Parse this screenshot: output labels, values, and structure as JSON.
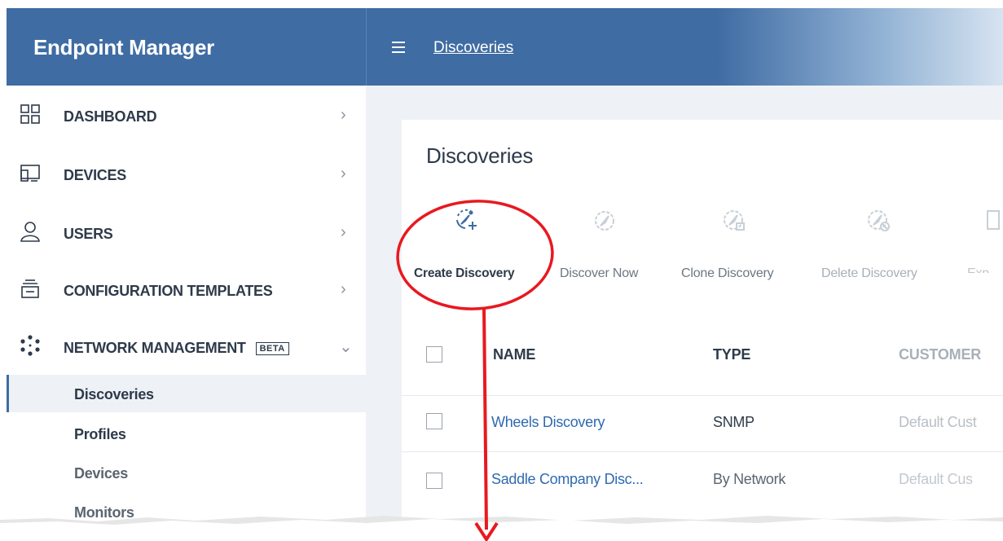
{
  "app": {
    "title": "Endpoint Manager"
  },
  "header": {
    "breadcrumb": "Discoveries"
  },
  "sidebar": {
    "items": [
      {
        "label": "DASHBOARD",
        "icon": "dashboard-icon"
      },
      {
        "label": "DEVICES",
        "icon": "devices-icon"
      },
      {
        "label": "USERS",
        "icon": "user-icon"
      },
      {
        "label": "CONFIGURATION TEMPLATES",
        "icon": "templates-icon"
      },
      {
        "label": "NETWORK MANAGEMENT",
        "icon": "network-icon",
        "badge": "BETA",
        "expanded": true
      }
    ],
    "subitems": [
      {
        "label": "Discoveries",
        "active": true
      },
      {
        "label": "Profiles"
      },
      {
        "label": "Devices"
      },
      {
        "label": "Monitors"
      }
    ]
  },
  "main": {
    "title": "Discoveries",
    "toolbar": [
      {
        "label": "Create Discovery",
        "enabled": true,
        "icon": "create-discovery-icon"
      },
      {
        "label": "Discover Now",
        "enabled": false,
        "icon": "discover-now-icon"
      },
      {
        "label": "Clone Discovery",
        "enabled": false,
        "icon": "clone-discovery-icon"
      },
      {
        "label": "Delete Discovery",
        "enabled": false,
        "icon": "delete-discovery-icon"
      },
      {
        "label": "Exp",
        "enabled": false,
        "icon": "export-icon"
      }
    ],
    "table": {
      "columns": [
        "NAME",
        "TYPE",
        "CUSTOMER"
      ],
      "rows": [
        {
          "name": "Wheels Discovery",
          "type": "SNMP",
          "customer": "Default Cust"
        },
        {
          "name": "Saddle Company Disc...",
          "type": "By Network",
          "customer": "Default Cus"
        }
      ]
    }
  },
  "colors": {
    "header_bg": "#3f6ca3",
    "link": "#2f6ab0",
    "text": "#2e3a4a",
    "annotation": "#e8191f"
  }
}
